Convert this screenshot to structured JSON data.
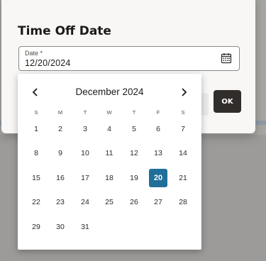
{
  "dialog": {
    "title": "Time Off Date",
    "date_field": {
      "label": "Date *",
      "value": "12/20/2024",
      "icon": "calendar-icon"
    },
    "ok_label": "OK"
  },
  "calendar": {
    "month_label": "December 2024",
    "prev_icon": "chevron-left-icon",
    "next_icon": "chevron-right-icon",
    "weekdays": [
      "S",
      "M",
      "T",
      "W",
      "T",
      "F",
      "S"
    ],
    "weeks": [
      [
        "1",
        "2",
        "3",
        "4",
        "5",
        "6",
        "7"
      ],
      [
        "8",
        "9",
        "10",
        "11",
        "12",
        "13",
        "14"
      ],
      [
        "15",
        "16",
        "17",
        "18",
        "19",
        "20",
        "21"
      ],
      [
        "22",
        "23",
        "24",
        "25",
        "26",
        "27",
        "28"
      ],
      [
        "29",
        "30",
        "31"
      ]
    ],
    "selected_day": "20",
    "colors": {
      "selected_bg": "#1f6f99",
      "ok_bg": "#312d2a"
    }
  }
}
